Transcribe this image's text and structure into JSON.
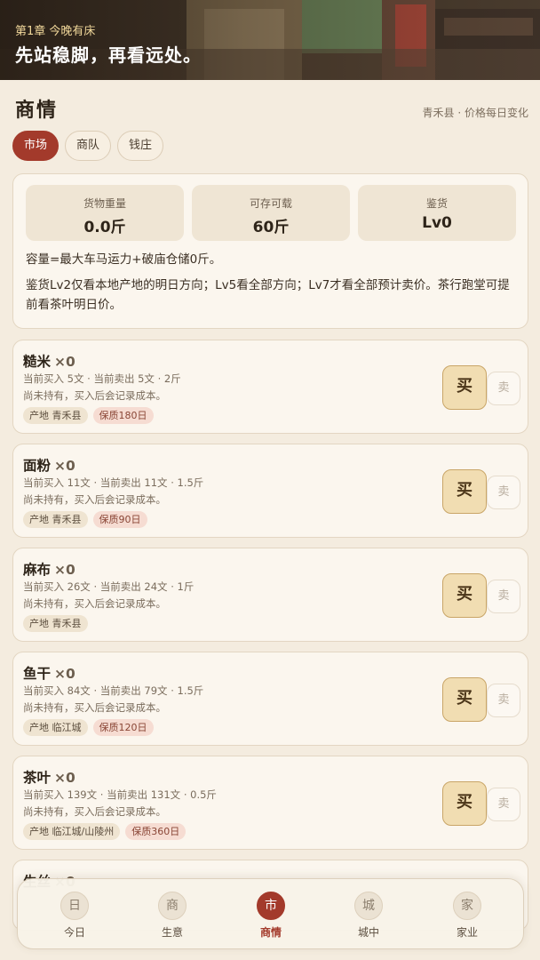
{
  "banner": {
    "chapter": "第1章 今晚有床",
    "headline": "先站稳脚，再看远处。"
  },
  "page": {
    "title": "商情",
    "subtitle": "青禾县 · 价格每日变化"
  },
  "tabs": [
    {
      "label": "市场",
      "active": true
    },
    {
      "label": "商队",
      "active": false
    },
    {
      "label": "钱庄",
      "active": false
    }
  ],
  "summary": {
    "stats": [
      {
        "label": "货物重量",
        "value": "0.0斤"
      },
      {
        "label": "可存可载",
        "value": "60斤"
      },
      {
        "label": "鉴货",
        "value": "Lv0"
      }
    ],
    "capacity_note": "容量=最大车马运力+破庙仓储0斤。",
    "appraisal_note": "鉴货Lv2仅看本地产地的明日方向；Lv5看全部方向；Lv7才看全部预计卖价。茶行跑堂可提前看茶叶明日价。"
  },
  "items": [
    {
      "name": "糙米",
      "qty": "×0",
      "price": "当前买入 5文 · 当前卖出 5文 · 2斤",
      "hold": "尚未持有，买入后会记录成本。",
      "origin": "产地 青禾县",
      "shelf": "保质180日"
    },
    {
      "name": "面粉",
      "qty": "×0",
      "price": "当前买入 11文 · 当前卖出 11文 · 1.5斤",
      "hold": "尚未持有，买入后会记录成本。",
      "origin": "产地 青禾县",
      "shelf": "保质90日"
    },
    {
      "name": "麻布",
      "qty": "×0",
      "price": "当前买入 26文 · 当前卖出 24文 · 1斤",
      "hold": "尚未持有，买入后会记录成本。",
      "origin": "产地 青禾县",
      "shelf": ""
    },
    {
      "name": "鱼干",
      "qty": "×0",
      "price": "当前买入 84文 · 当前卖出 79文 · 1.5斤",
      "hold": "尚未持有，买入后会记录成本。",
      "origin": "产地 临江城",
      "shelf": "保质120日"
    },
    {
      "name": "茶叶",
      "qty": "×0",
      "price": "当前买入 139文 · 当前卖出 131文 · 0.5斤",
      "hold": "尚未持有，买入后会记录成本。",
      "origin": "产地 临江城/山陵州",
      "shelf": "保质360日"
    }
  ],
  "partial_item": {
    "name": "生丝",
    "qty": "×0"
  },
  "actions": {
    "buy": "买",
    "sell": "卖"
  },
  "nav": [
    {
      "glyph": "日",
      "label": "今日",
      "active": false
    },
    {
      "glyph": "商",
      "label": "生意",
      "active": false
    },
    {
      "glyph": "市",
      "label": "商情",
      "active": true
    },
    {
      "glyph": "城",
      "label": "城中",
      "active": false
    },
    {
      "glyph": "家",
      "label": "家业",
      "active": false
    }
  ],
  "colors": {
    "accent": "#a33a2b",
    "background": "#f4ecdf",
    "card": "#fbf6ee",
    "buy_button": "#f1ddb2"
  }
}
